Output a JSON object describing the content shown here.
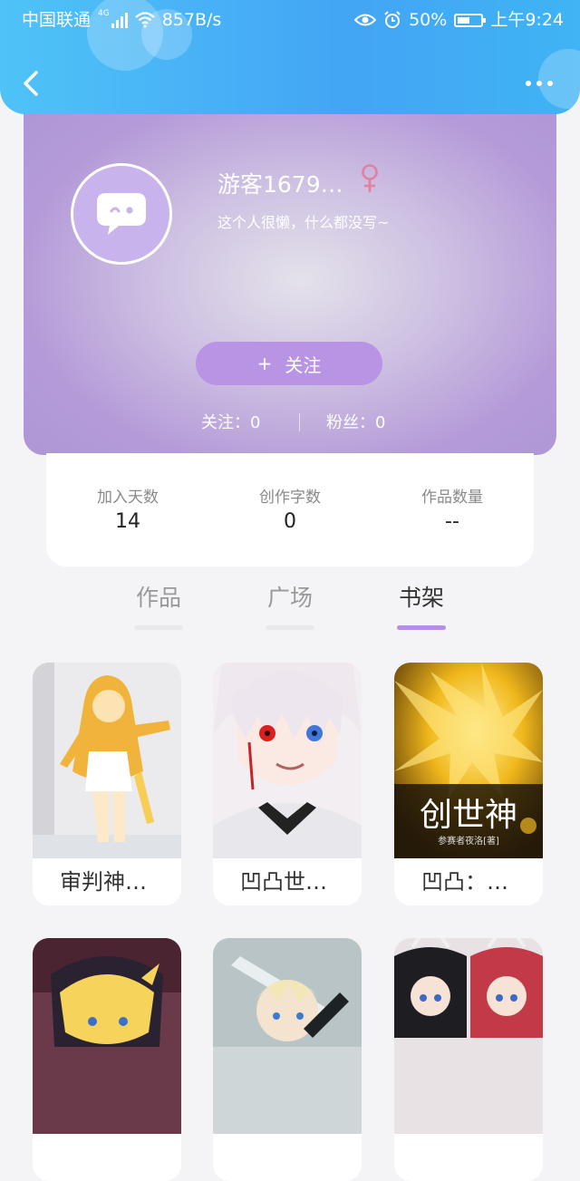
{
  "status_bar": {
    "carrier": "中国联通",
    "network": "4G",
    "speed": "857B/s",
    "battery": "50%",
    "time": "上午9:24"
  },
  "nav": {
    "back_icon": "chevron-left-icon",
    "more_icon": "more-dots-icon"
  },
  "profile": {
    "username": "游客1679…",
    "gender_icon": "female-icon",
    "bio": "这个人很懒，什么都没写~",
    "follow_button": "关注",
    "follow_prefix": "+",
    "following_label": "关注：",
    "following_count": "0",
    "fans_label": "粉丝：",
    "fans_count": "0"
  },
  "info": [
    {
      "label": "加入天数",
      "value": "14"
    },
    {
      "label": "创作字数",
      "value": "0"
    },
    {
      "label": "作品数量",
      "value": "--"
    }
  ],
  "tabs": [
    {
      "label": "作品",
      "active": false
    },
    {
      "label": "广场",
      "active": false
    },
    {
      "label": "书架",
      "active": true
    }
  ],
  "books": [
    {
      "title": "审判神…"
    },
    {
      "title": "凹凸世…"
    },
    {
      "title": "凹凸：…",
      "cover_text": "创世神",
      "cover_sub": "参赛者夜洛[著]"
    },
    {
      "title": ""
    },
    {
      "title": ""
    },
    {
      "title": ""
    }
  ],
  "colors": {
    "header": "#42a5f5",
    "profile_bg": "#ad96d6",
    "accent": "#b68ee6",
    "gender": "#e57fa0"
  }
}
